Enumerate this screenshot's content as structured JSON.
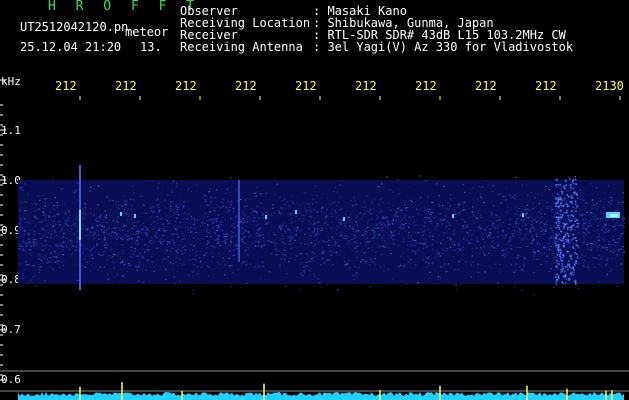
{
  "header": {
    "title": "H R O F F T",
    "filename": "UT2512042120.pn",
    "mode": "meteor",
    "datetime": "25.12.04 21:20",
    "counter": "13.",
    "fields": [
      {
        "label": "Observer",
        "value": ": Masaki Kano"
      },
      {
        "label": "Receiving Location",
        "value": ": Shibukawa, Gunma, Japan"
      },
      {
        "label": "Receiver",
        "value": ": RTL-SDR SDR# 43dB L15 103.2MHz CW"
      },
      {
        "label": "Receiving Antenna",
        "value": ": 3el Yagi(V) Az 330 for Vladivostok"
      }
    ]
  },
  "x_axis": {
    "tick_labels": [
      "212",
      "212",
      "212",
      "212",
      "212",
      "212",
      "212",
      "212",
      "212",
      "2130"
    ]
  },
  "y_axis": {
    "unit": "kHz",
    "tick_labels": [
      "1.1",
      "1.0",
      "0.9",
      "0.8",
      "0.7",
      "0.6"
    ]
  },
  "colors": {
    "background": "#000000",
    "title": "#36e04a",
    "tick_label": "#ffff40",
    "noise_band": "#1a2a9a",
    "signal": "#60d0ff",
    "baseline": "#20d0ff",
    "spike": "#ffff40"
  }
}
